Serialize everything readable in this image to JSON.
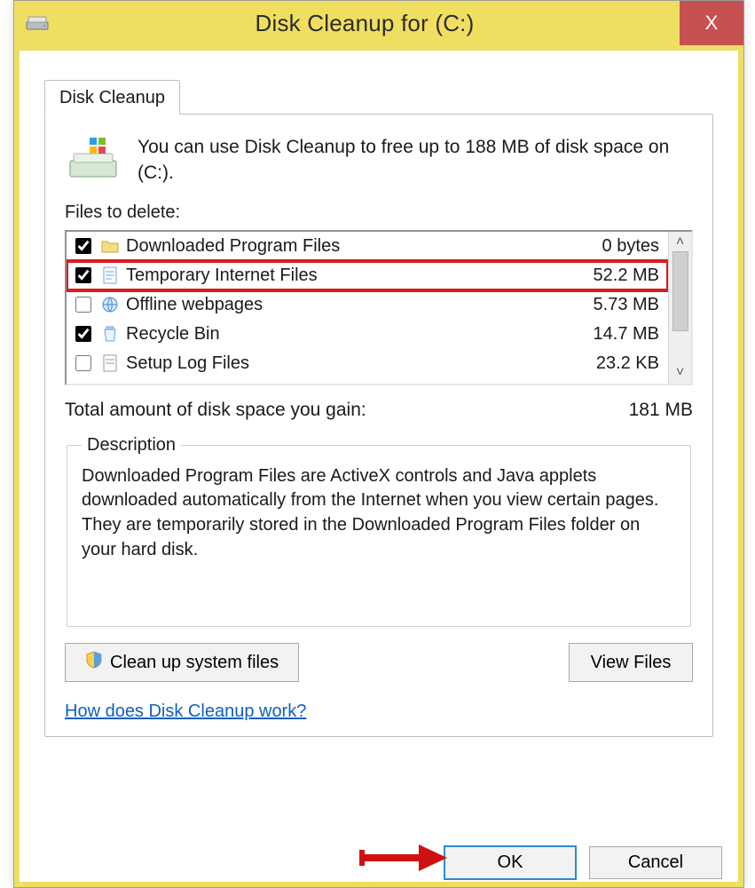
{
  "titlebar": {
    "title": "Disk Cleanup for  (C:)",
    "close_glyph": "X"
  },
  "tab": {
    "label": "Disk Cleanup"
  },
  "info": {
    "text": "You can use Disk Cleanup to free up to 188 MB of disk space on  (C:)."
  },
  "files_label": "Files to delete:",
  "rows": [
    {
      "checked": true,
      "icon": "folder-icon",
      "label": "Downloaded Program Files",
      "size": "0 bytes",
      "highlight": false
    },
    {
      "checked": true,
      "icon": "document-icon",
      "label": "Temporary Internet Files",
      "size": "52.2 MB",
      "highlight": true
    },
    {
      "checked": false,
      "icon": "offline-web-icon",
      "label": "Offline webpages",
      "size": "5.73 MB",
      "highlight": false
    },
    {
      "checked": true,
      "icon": "recycle-bin-icon",
      "label": "Recycle Bin",
      "size": "14.7 MB",
      "highlight": false
    },
    {
      "checked": false,
      "icon": "log-file-icon",
      "label": "Setup Log Files",
      "size": "23.2 KB",
      "highlight": false
    }
  ],
  "gain": {
    "label": "Total amount of disk space you gain:",
    "value": "181 MB"
  },
  "description": {
    "legend": "Description",
    "text": "Downloaded Program Files are ActiveX controls and Java applets downloaded automatically from the Internet when you view certain pages. They are temporarily stored in the Downloaded Program Files folder on your hard disk."
  },
  "buttons": {
    "clean_system": "Clean up system files",
    "view_files": "View Files",
    "ok": "OK",
    "cancel": "Cancel"
  },
  "help_link": "How does Disk Cleanup work?"
}
